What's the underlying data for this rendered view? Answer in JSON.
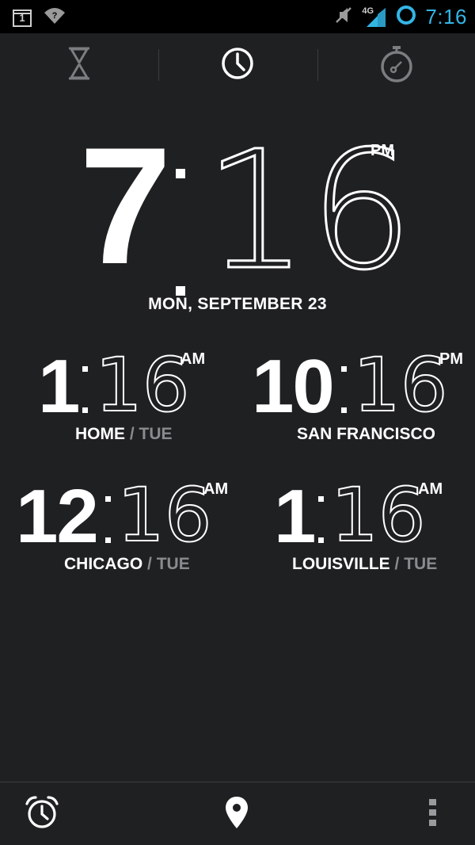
{
  "status_bar": {
    "notification_count": "1",
    "network_type": "4G",
    "time": "7:16",
    "colors": {
      "time": "#33b5e5",
      "sync": "#33b5e5",
      "signal": "#33b5e5"
    },
    "icons": [
      "notification-box-icon",
      "wifi-question-icon",
      "vibrate-muted-icon",
      "signal-4g-icon",
      "sync-ring-icon"
    ]
  },
  "tabs": [
    {
      "name": "timer",
      "icon": "hourglass-icon",
      "selected": false
    },
    {
      "name": "clock",
      "icon": "clock-icon",
      "selected": true
    },
    {
      "name": "stopwatch",
      "icon": "stopwatch-icon",
      "selected": false
    }
  ],
  "main_clock": {
    "hour": "7",
    "minutes": "16",
    "ampm": "PM",
    "date": "MON, SEPTEMBER 23"
  },
  "world_clocks": [
    {
      "hour": "1",
      "minutes": "16",
      "ampm": "AM",
      "city": "HOME",
      "separator": "/",
      "day": "TUE"
    },
    {
      "hour": "10",
      "minutes": "16",
      "ampm": "PM",
      "city": "SAN FRANCISCO",
      "separator": "",
      "day": ""
    },
    {
      "hour": "12",
      "minutes": "16",
      "ampm": "AM",
      "city": "CHICAGO",
      "separator": "/",
      "day": "TUE"
    },
    {
      "hour": "1",
      "minutes": "16",
      "ampm": "AM",
      "city": "LOUISVILLE",
      "separator": "/",
      "day": "TUE"
    }
  ],
  "bottom_bar": {
    "icons": [
      "alarm-clock-icon",
      "location-pin-icon",
      "overflow-menu-icon"
    ]
  }
}
